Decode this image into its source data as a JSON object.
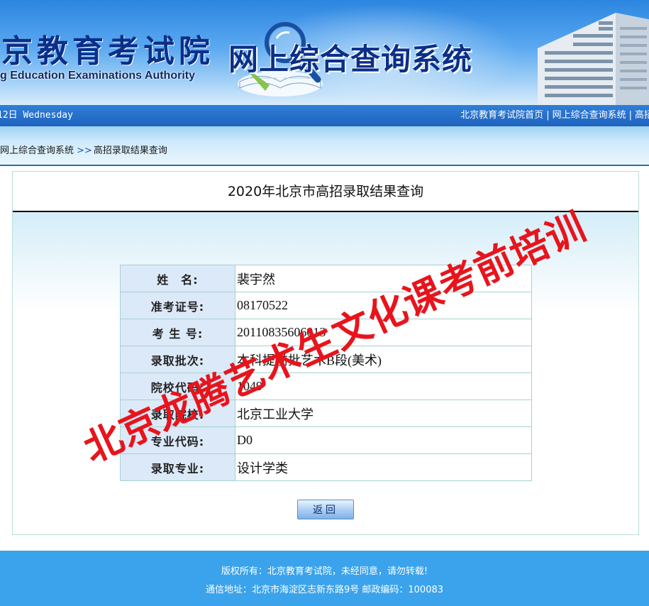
{
  "header": {
    "org_name_cn": "京教育考试院",
    "org_name_en": "g Education Examinations Authority",
    "system_title": "网上综合查询系统"
  },
  "navbar": {
    "date_text": "12日 Wednesday",
    "links": [
      {
        "label": "北京教育考试院首页"
      },
      {
        "label": "网上综合查询系统"
      },
      {
        "label": "高招"
      }
    ],
    "separator": "|"
  },
  "breadcrumb": {
    "root": "网上综合查询系统",
    "arrow": ">>",
    "current": "高招录取结果查询"
  },
  "main": {
    "title": "2020年北京市高招录取结果查询",
    "rows": [
      {
        "label": "姓　名:",
        "value": "裴宇然"
      },
      {
        "label": "准考证号:",
        "value": "08170522"
      },
      {
        "label": "考 生 号:",
        "value": "20110835606013"
      },
      {
        "label": "录取批次:",
        "value": "本科提前批艺术B段(美术)"
      },
      {
        "label": "院校代码:",
        "value": "1049"
      },
      {
        "label": "录取院校:",
        "value": "北京工业大学"
      },
      {
        "label": "专业代码:",
        "value": "D0"
      },
      {
        "label": "录取专业:",
        "value": "设计学类"
      }
    ],
    "back_label": "返回"
  },
  "footer": {
    "copyright": "版权所有：北京教育考试院，未经同意，请勿转载!",
    "address": "通信地址：北京市海淀区志新东路9号 邮政编码：100083"
  },
  "watermark": {
    "text": "北京龙腾艺术生文化课考前培训",
    "color": "#e8141c"
  },
  "colors": {
    "nav_bar": "#1f63bd",
    "footer": "#3aa3ec",
    "label_cell": "#dce9f8",
    "title_text": "#0b2f88"
  }
}
